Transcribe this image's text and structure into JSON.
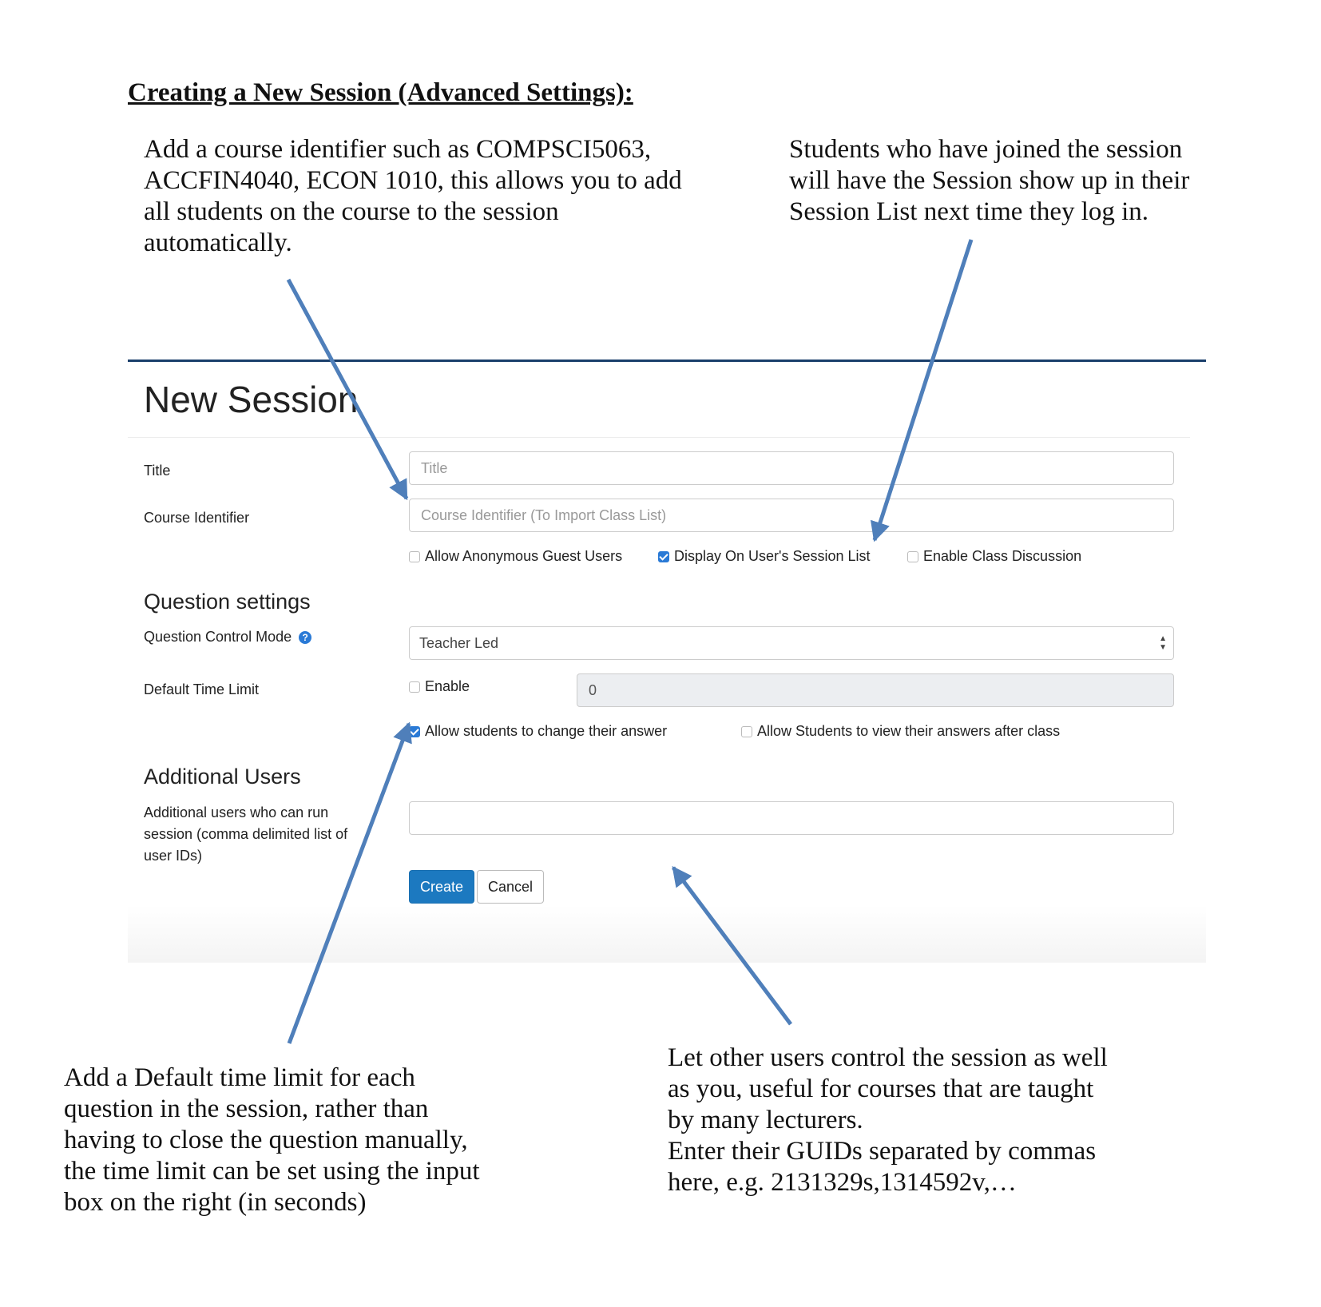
{
  "doc": {
    "heading": "Creating a New Session (Advanced Settings):",
    "note_course": [
      "Add a course identifier such as COMPSCI5063,",
      "ACCFIN4040, ECON 1010, this allows you to add",
      "all students on the course to the session",
      "automatically."
    ],
    "note_students": [
      "Students who have joined the session",
      "will have the Session show up in their",
      "Session List next time they log in."
    ],
    "note_time": [
      "Add a Default time limit for each",
      "question in the session, rather than",
      "having to close the question manually,",
      "the time limit can be set using the input",
      "box on the right (in seconds)"
    ],
    "note_users": [
      "Let other users control the session as well",
      "as you, useful for courses that are taught",
      "by many lecturers.",
      "Enter their GUIDs separated by commas",
      "here, e.g. 2131329s,1314592v,…"
    ]
  },
  "form": {
    "page_title": "New Session",
    "title": {
      "label": "Title",
      "placeholder": "Title",
      "value": ""
    },
    "course": {
      "label": "Course Identifier",
      "placeholder": "Course Identifier (To Import Class List)",
      "value": ""
    },
    "options": [
      {
        "label": "Allow Anonymous Guest Users",
        "checked": false
      },
      {
        "label": "Display On User's Session List",
        "checked": true
      },
      {
        "label": "Enable Class Discussion",
        "checked": false
      }
    ],
    "question_settings": {
      "heading": "Question settings",
      "control_mode": {
        "label": "Question Control Mode",
        "selected": "Teacher Led",
        "help_icon": "question-circle-icon"
      },
      "time_limit": {
        "label": "Default Time Limit",
        "enable_label": "Enable",
        "enabled": false,
        "value": "0"
      },
      "options": [
        {
          "label": "Allow students to change their answer",
          "checked": true
        },
        {
          "label": "Allow Students to view their answers after class",
          "checked": false
        }
      ]
    },
    "additional_users": {
      "heading": "Additional Users",
      "label_lines": [
        "Additional users who can run",
        "session (comma delimited list of",
        "user IDs)"
      ],
      "value": ""
    },
    "buttons": {
      "create": "Create",
      "cancel": "Cancel"
    }
  },
  "colors": {
    "arrow": "#4f7fba",
    "primary": "#1c79c0",
    "checkbox": "#2a7ad6",
    "panel_border": "#1a3f6b"
  }
}
